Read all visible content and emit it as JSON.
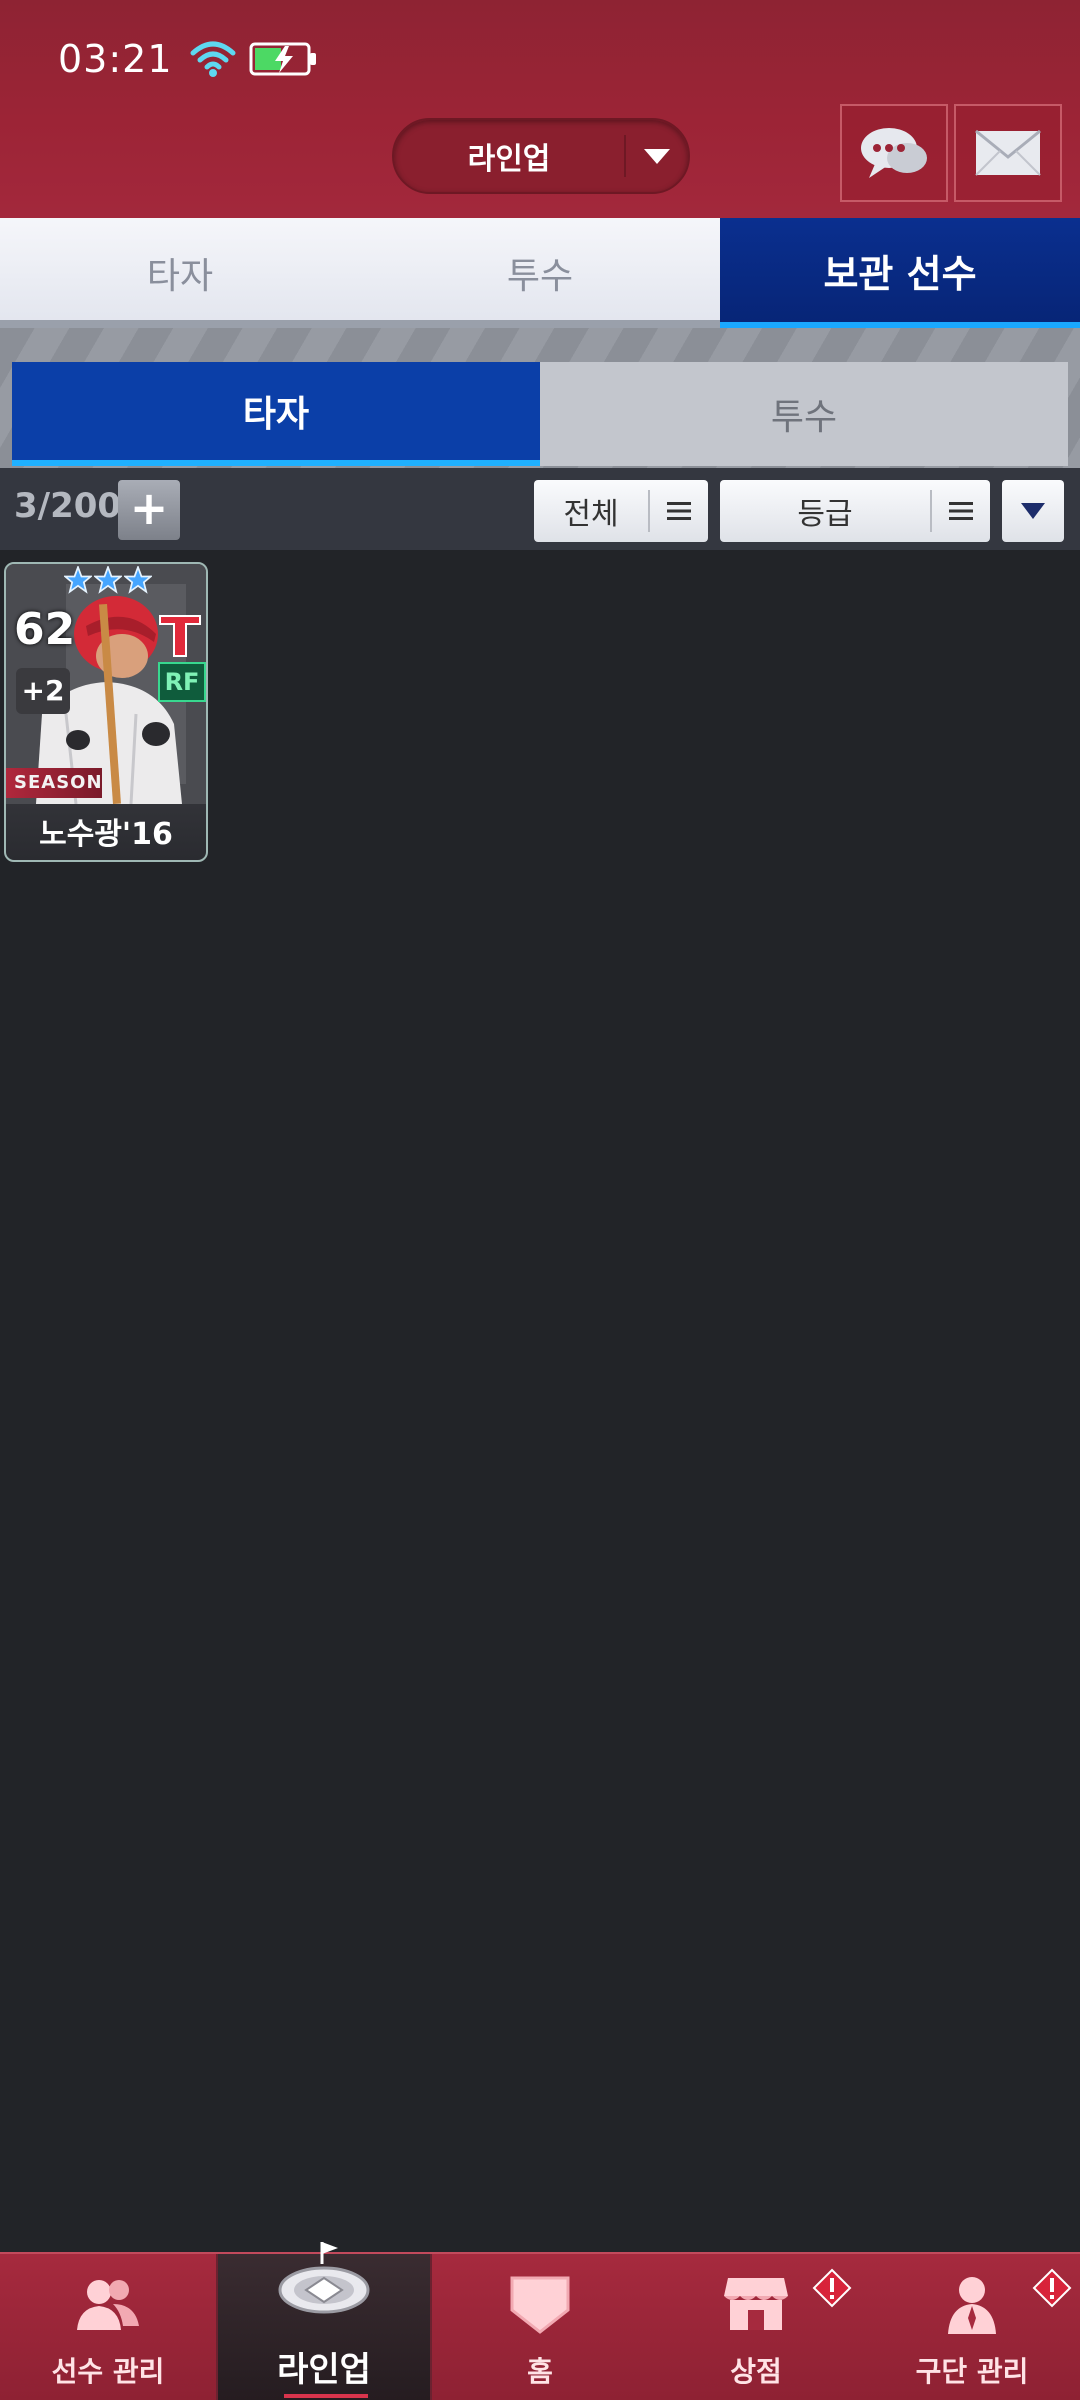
{
  "status_bar": {
    "time": "03:21"
  },
  "header": {
    "dropdown_label": "라인업",
    "chat_icon": "chat-bubble-icon",
    "mail_icon": "envelope-icon"
  },
  "main_tabs": [
    {
      "label": "타자",
      "active": false
    },
    {
      "label": "투수",
      "active": false
    },
    {
      "label": "보관 선수",
      "active": true
    }
  ],
  "sub_tabs": [
    {
      "label": "타자",
      "active": true
    },
    {
      "label": "투수",
      "active": false
    }
  ],
  "toolbar": {
    "count": "3/200",
    "add_label": "+",
    "filter_all": "전체",
    "filter_grade": "등급"
  },
  "cards": [
    {
      "overall": "62",
      "upgrade": "+2",
      "position": "RF",
      "season_label": "SEASON",
      "name": "노수광'16",
      "stars": 3
    }
  ],
  "bottom_nav": [
    {
      "label": "선수 관리",
      "icon": "players-icon",
      "active": false,
      "badge": false
    },
    {
      "label": "라인업",
      "icon": "stadium-icon",
      "active": true,
      "badge": false
    },
    {
      "label": "홈",
      "icon": "home-plate-icon",
      "active": false,
      "badge": false
    },
    {
      "label": "상점",
      "icon": "shop-icon",
      "active": false,
      "badge": true
    },
    {
      "label": "구단 관리",
      "icon": "manager-icon",
      "active": false,
      "badge": true
    }
  ],
  "colors": {
    "header_red": "#9c2436",
    "tab_active_blue": "#0a2f8f",
    "accent_cyan": "#1aa8ff",
    "background": "#222428"
  }
}
